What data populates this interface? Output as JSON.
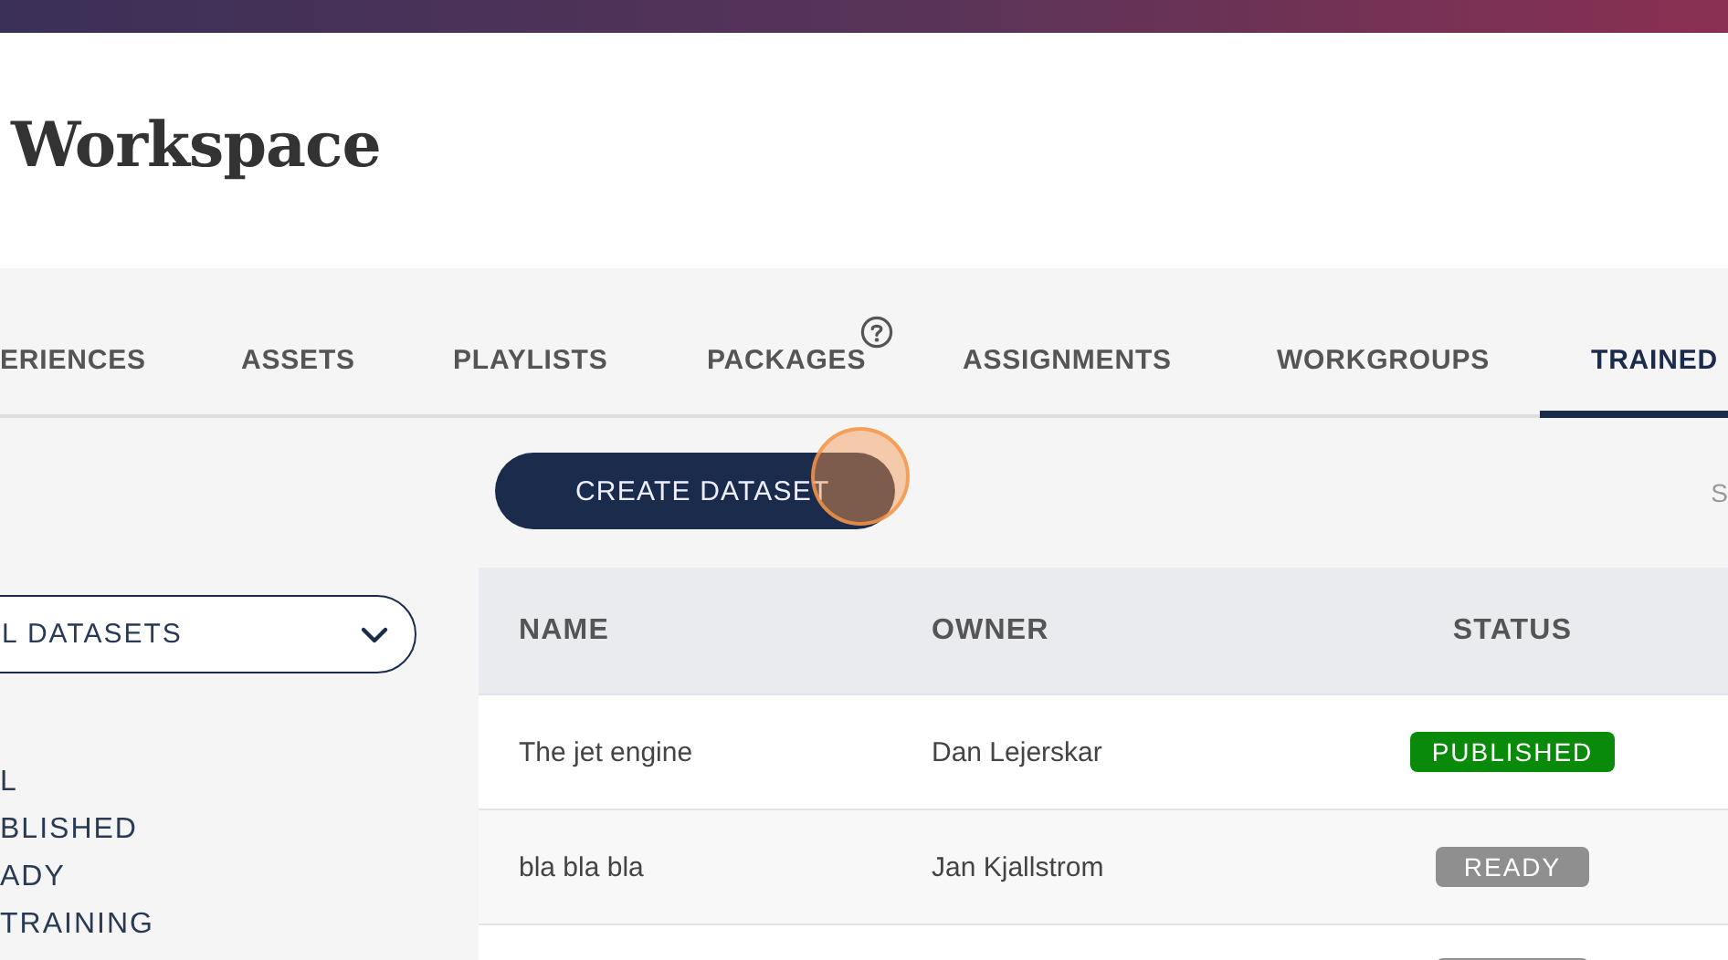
{
  "header": {
    "title": "Workspace"
  },
  "tabs": [
    {
      "label": "ERIENCES",
      "selected": false,
      "help": false
    },
    {
      "label": "ASSETS",
      "selected": false,
      "help": false
    },
    {
      "label": "PLAYLISTS",
      "selected": false,
      "help": false
    },
    {
      "label": "PACKAGES",
      "selected": false,
      "help": true
    },
    {
      "label": "ASSIGNMENTS",
      "selected": false,
      "help": false
    },
    {
      "label": "WORKGROUPS",
      "selected": false,
      "help": false
    },
    {
      "label": "TRAINED",
      "selected": true,
      "help": false
    }
  ],
  "create_button": {
    "label": "CREATE DATASET"
  },
  "search_hint": "S",
  "sidebar": {
    "dropdown": {
      "value": "L DATASETS"
    },
    "filters": [
      {
        "label": "L"
      },
      {
        "label": "BLISHED"
      },
      {
        "label": "ADY"
      },
      {
        "label": "TRAINING"
      }
    ]
  },
  "table": {
    "columns": [
      "NAME",
      "OWNER",
      "STATUS"
    ],
    "rows": [
      {
        "name": "The jet engine",
        "owner": "Dan Lejerskar",
        "status": "PUBLISHED",
        "color": "#0a8a0a"
      },
      {
        "name": "bla bla bla",
        "owner": "Jan Kjallstrom",
        "status": "READY",
        "color": "#8f8f8f"
      },
      {
        "color": "#8f8f8f"
      }
    ]
  }
}
